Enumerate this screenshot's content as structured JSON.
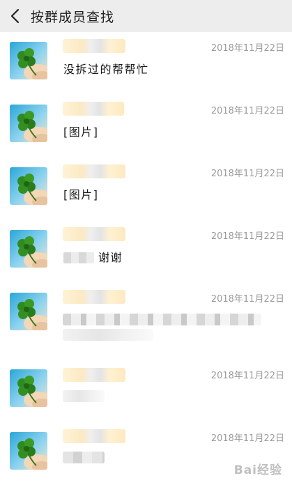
{
  "header": {
    "title": "按群成员查找",
    "back_icon": "chevron-left-icon"
  },
  "messages": [
    {
      "time": "2018年11月22日",
      "text": "没拆过的帮帮忙"
    },
    {
      "time": "2018年11月22日",
      "text": "[图片]"
    },
    {
      "time": "2018年11月22日",
      "text": "[图片]"
    },
    {
      "time": "2018年11月22日",
      "text": "谢谢"
    },
    {
      "time": "2018年11月22日",
      "text": ""
    },
    {
      "time": "2018年11月22日",
      "text": ""
    },
    {
      "time": "2018年11月22日",
      "text": ""
    }
  ],
  "watermark": "Bai经验",
  "colors": {
    "header_bg": "#ededed",
    "timestamp": "#9b9b9b",
    "text": "#1a1a1a"
  }
}
